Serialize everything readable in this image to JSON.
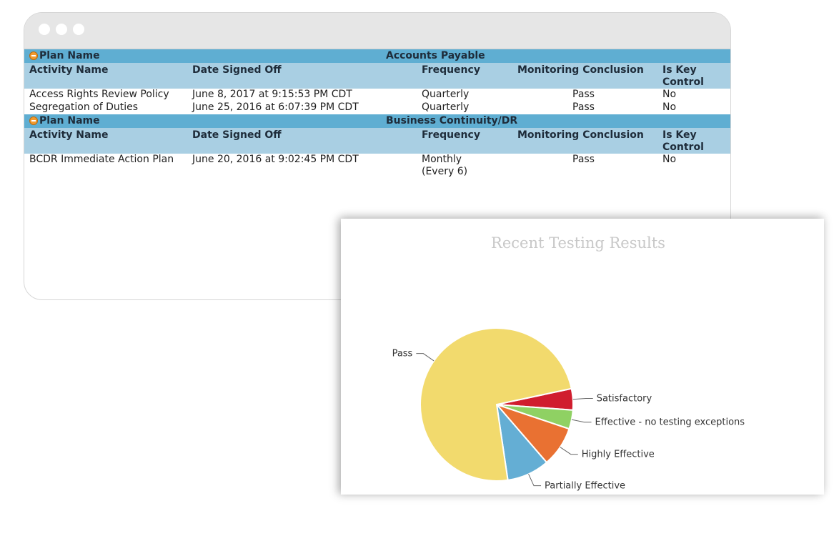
{
  "window": {
    "controls": [
      "close",
      "minimize",
      "maximize"
    ]
  },
  "report": {
    "headers": {
      "plan": "Plan Name",
      "activity": "Activity Name",
      "date": "Date Signed Off",
      "frequency": "Frequency",
      "conclusion": "Monitoring Conclusion",
      "key_control_line1": "Is Key",
      "key_control_line2": "Control"
    },
    "plans": [
      {
        "name": "Accounts Payable",
        "rows": [
          {
            "activity": "Access Rights Review Policy",
            "date": "June 8, 2017 at 9:15:53 PM CDT",
            "frequency": "Quarterly",
            "frequency_extra": "",
            "conclusion": "Pass",
            "key_control": "No"
          },
          {
            "activity": "Segregation of Duties",
            "date": "June 25, 2016 at 6:07:39 PM CDT",
            "frequency": "Quarterly",
            "frequency_extra": "",
            "conclusion": "Pass",
            "key_control": "No"
          }
        ]
      },
      {
        "name": "Business Continuity/DR",
        "rows": [
          {
            "activity": "BCDR Immediate Action Plan",
            "date": "June 20, 2016 at 9:02:45 PM CDT",
            "frequency": "Monthly",
            "frequency_extra": "(Every 6)",
            "conclusion": "Pass",
            "key_control": "No"
          }
        ]
      }
    ]
  },
  "chart_data": {
    "type": "pie",
    "title": "Recent Testing Results",
    "slices": [
      {
        "label": "Satisfactory",
        "value": 4.5,
        "color": "#d01d2e"
      },
      {
        "label": "Effective - no testing exceptions",
        "value": 4.0,
        "color": "#8fd163"
      },
      {
        "label": "Highly Effective",
        "value": 8.5,
        "color": "#e97132"
      },
      {
        "label": "Partially Effective",
        "value": 9.0,
        "color": "#64aed4"
      },
      {
        "label": "Pass",
        "value": 74.0,
        "color": "#f2da6d"
      }
    ],
    "start_angle_deg": -12,
    "legend": "none (outside labels with leader lines)"
  }
}
